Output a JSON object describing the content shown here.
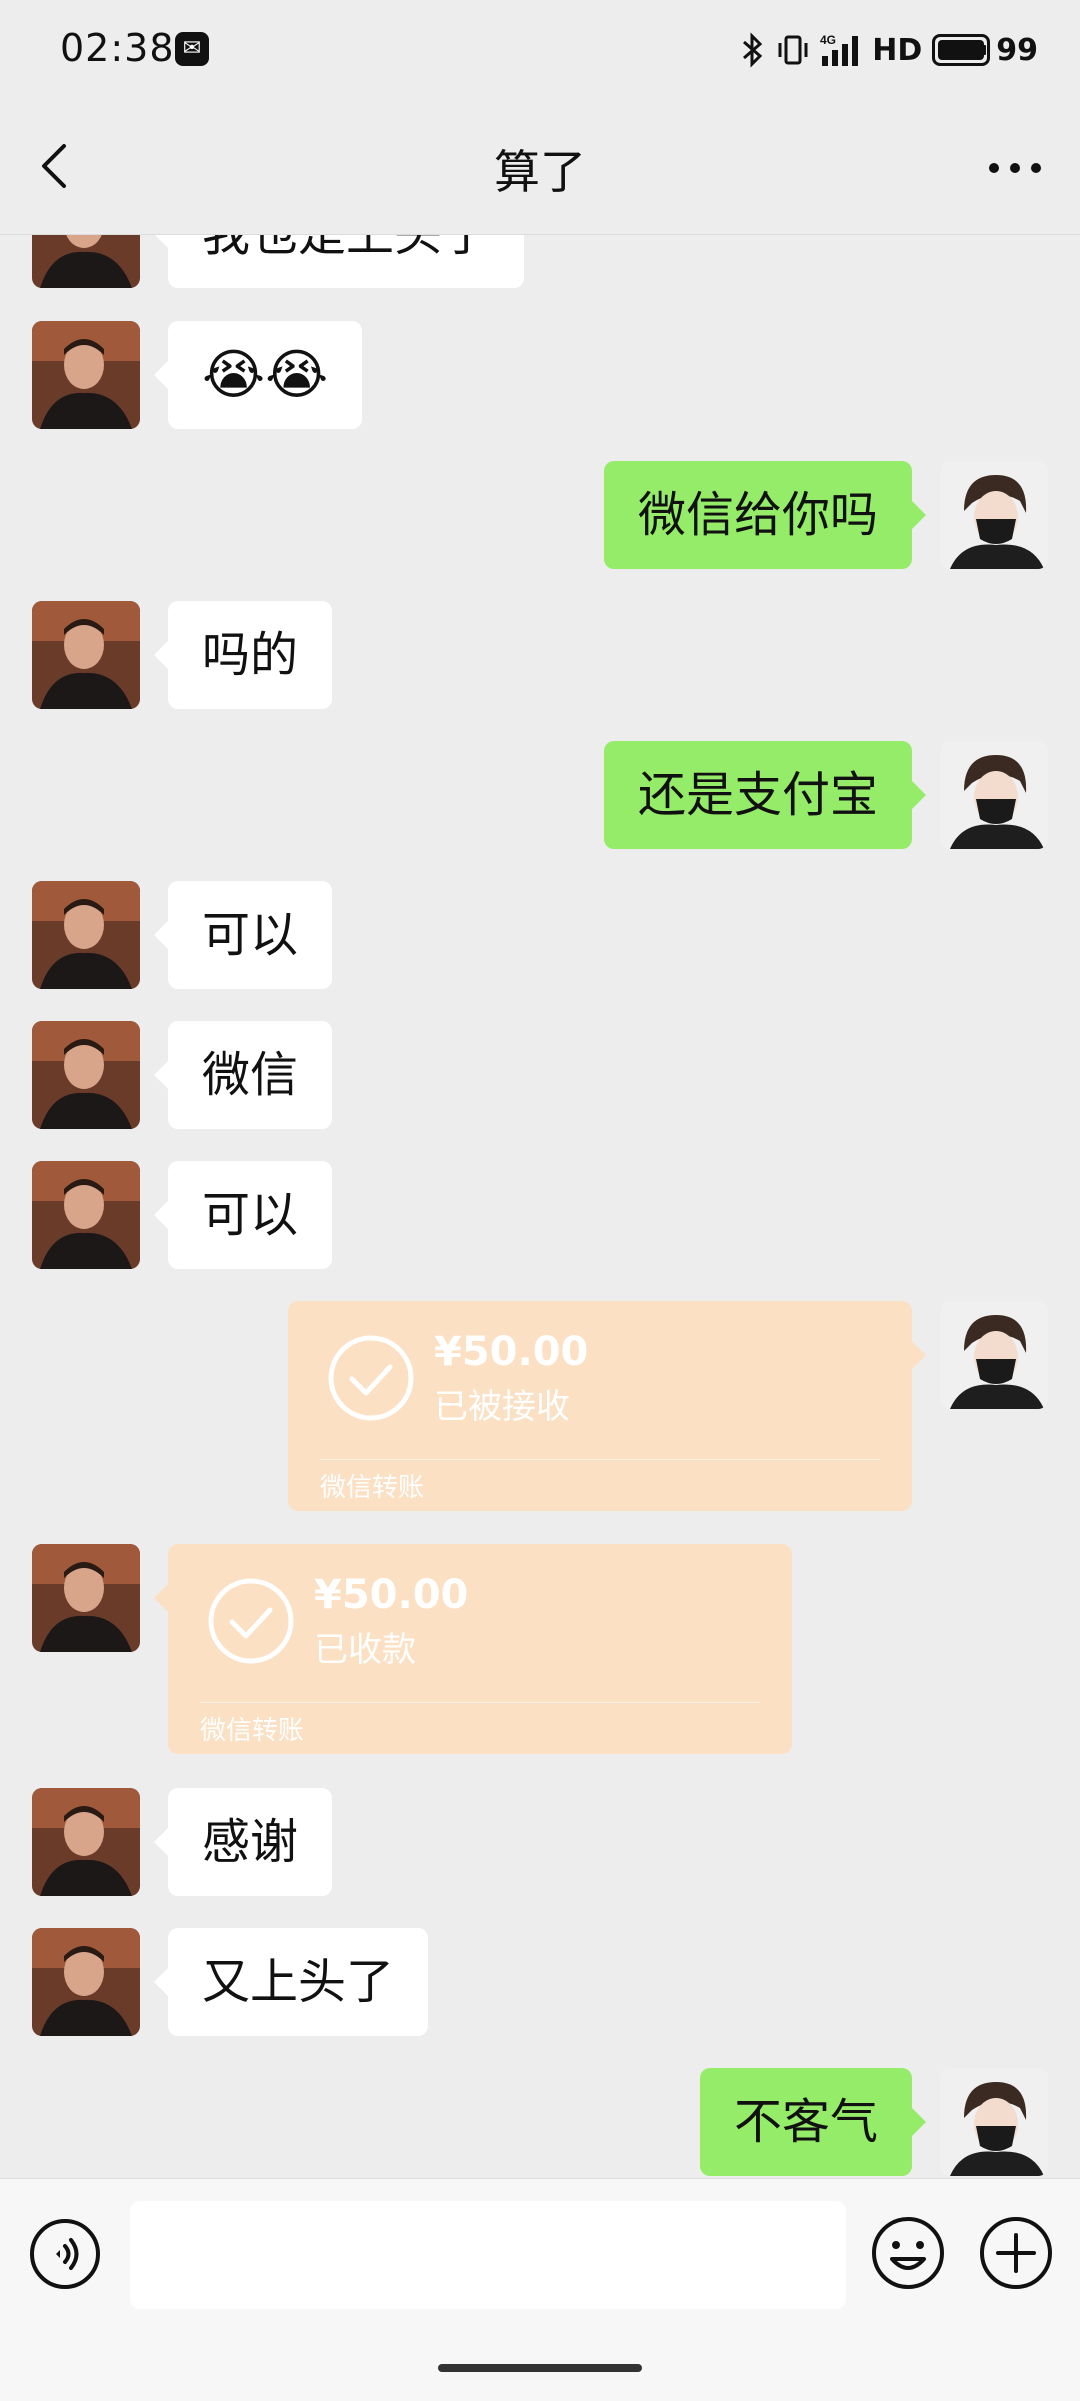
{
  "status_bar": {
    "time": "02:38",
    "network_label": "HD",
    "battery": "99",
    "icons": [
      "notification-icon",
      "bluetooth-icon",
      "vibrate-icon",
      "signal-4g-icon",
      "battery-icon"
    ]
  },
  "header": {
    "title": "算了",
    "back_icon": "chevron-left-icon",
    "more_icon": "more-dots-icon"
  },
  "messages": [
    {
      "side": "left",
      "type": "text",
      "text": "我也是上头了"
    },
    {
      "side": "left",
      "type": "emoji",
      "text": "😭😭"
    },
    {
      "side": "right",
      "type": "text",
      "text": "微信给你吗"
    },
    {
      "side": "left",
      "type": "text",
      "text": "吗的"
    },
    {
      "side": "right",
      "type": "text",
      "text": "还是支付宝"
    },
    {
      "side": "left",
      "type": "text",
      "text": "可以"
    },
    {
      "side": "left",
      "type": "text",
      "text": "微信"
    },
    {
      "side": "left",
      "type": "text",
      "text": "可以"
    },
    {
      "side": "right",
      "type": "transfer",
      "amount": "¥50.00",
      "status": "已被接收",
      "footer": "微信转账"
    },
    {
      "side": "left",
      "type": "transfer",
      "amount": "¥50.00",
      "status": "已收款",
      "footer": "微信转账"
    },
    {
      "side": "left",
      "type": "text",
      "text": "感谢"
    },
    {
      "side": "left",
      "type": "text",
      "text": "又上头了"
    },
    {
      "side": "right",
      "type": "text",
      "text": "不客气"
    }
  ],
  "input_bar": {
    "placeholder": "",
    "voice_icon": "voice-icon",
    "emoji_icon": "emoji-icon",
    "plus_icon": "plus-icon"
  },
  "colors": {
    "background": "#ededed",
    "self_bubble": "#95ec69",
    "other_bubble": "#ffffff",
    "transfer_card": "#fbe0c3"
  }
}
